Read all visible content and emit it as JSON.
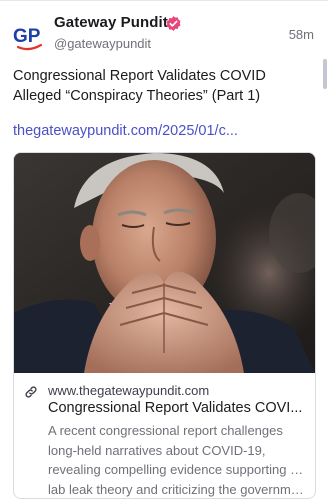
{
  "post": {
    "author": {
      "display_name": "Gateway Pundit",
      "handle": "@gatewaypundit",
      "avatar_text": "GP",
      "verified_icon": "verified-badge-icon"
    },
    "timestamp": "58m",
    "text": "Congressional Report Validates COVID Alleged “Conspiracy Theories” (Part 1)",
    "link_text": "thegatewaypundit.com/2025/01/c..."
  },
  "link_card": {
    "image_icon": "photo-of-man-with-clasped-hands",
    "domain_icon": "link-icon",
    "domain": "www.thegatewaypundit.com",
    "title": "Congressional Report Validates COVI...",
    "description_lines": [
      "A recent congressional report challenges",
      "long-held narratives about COVID-19,",
      "revealing compelling evidence supporting the",
      "lab leak theory and criticizing the governme..."
    ]
  },
  "colors": {
    "text_primary": "#1b1b1f",
    "text_secondary": "#6f7179",
    "link": "#4b50c9",
    "verified": "#e8457a",
    "avatar_blue": "#1f3fa8",
    "avatar_red": "#e1352c"
  }
}
